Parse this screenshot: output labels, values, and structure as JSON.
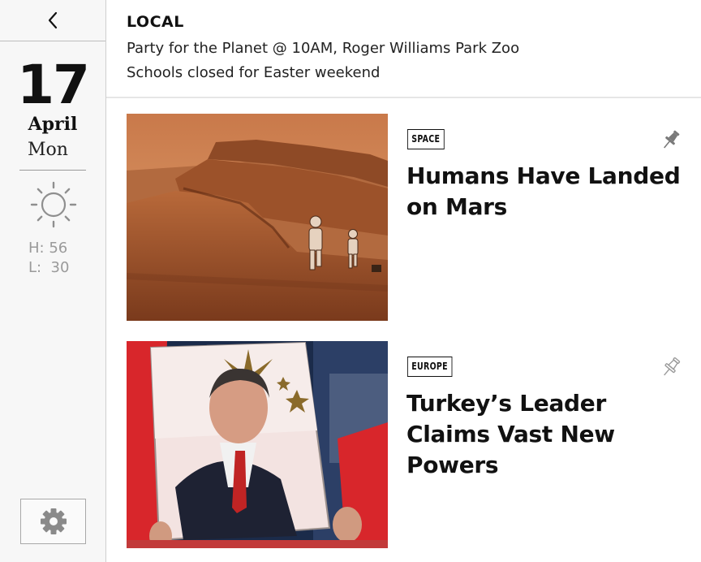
{
  "sidebar": {
    "back_icon": "chevron-left-icon",
    "date": {
      "day": "17",
      "month": "April",
      "weekday": "Mon"
    },
    "weather": {
      "icon": "sun-icon",
      "high": "H: 56",
      "low": "L:  30"
    },
    "settings_icon": "gear-icon"
  },
  "local": {
    "title": "LOCAL",
    "items": [
      "Party for the Planet @ 10AM, Roger Williams Park Zoo",
      "Schools closed for Easter weekend"
    ]
  },
  "articles": [
    {
      "tag": "SPACE",
      "headline": "Humans Have Landed on Mars",
      "image": "astronauts on martian rocky terrain",
      "pinned": true
    },
    {
      "tag": "EUROPE",
      "headline": "Turkey’s Leader Claims Vast New Powers",
      "image": "crowd holding a portrait of a leader",
      "pinned": false
    }
  ],
  "colors": {
    "mars_sky": "#d38a55",
    "mars_ground": "#a65a2c",
    "flag_red": "#d8262b",
    "pin_active": "#777777",
    "pin_inactive": "#aaaaaa"
  }
}
